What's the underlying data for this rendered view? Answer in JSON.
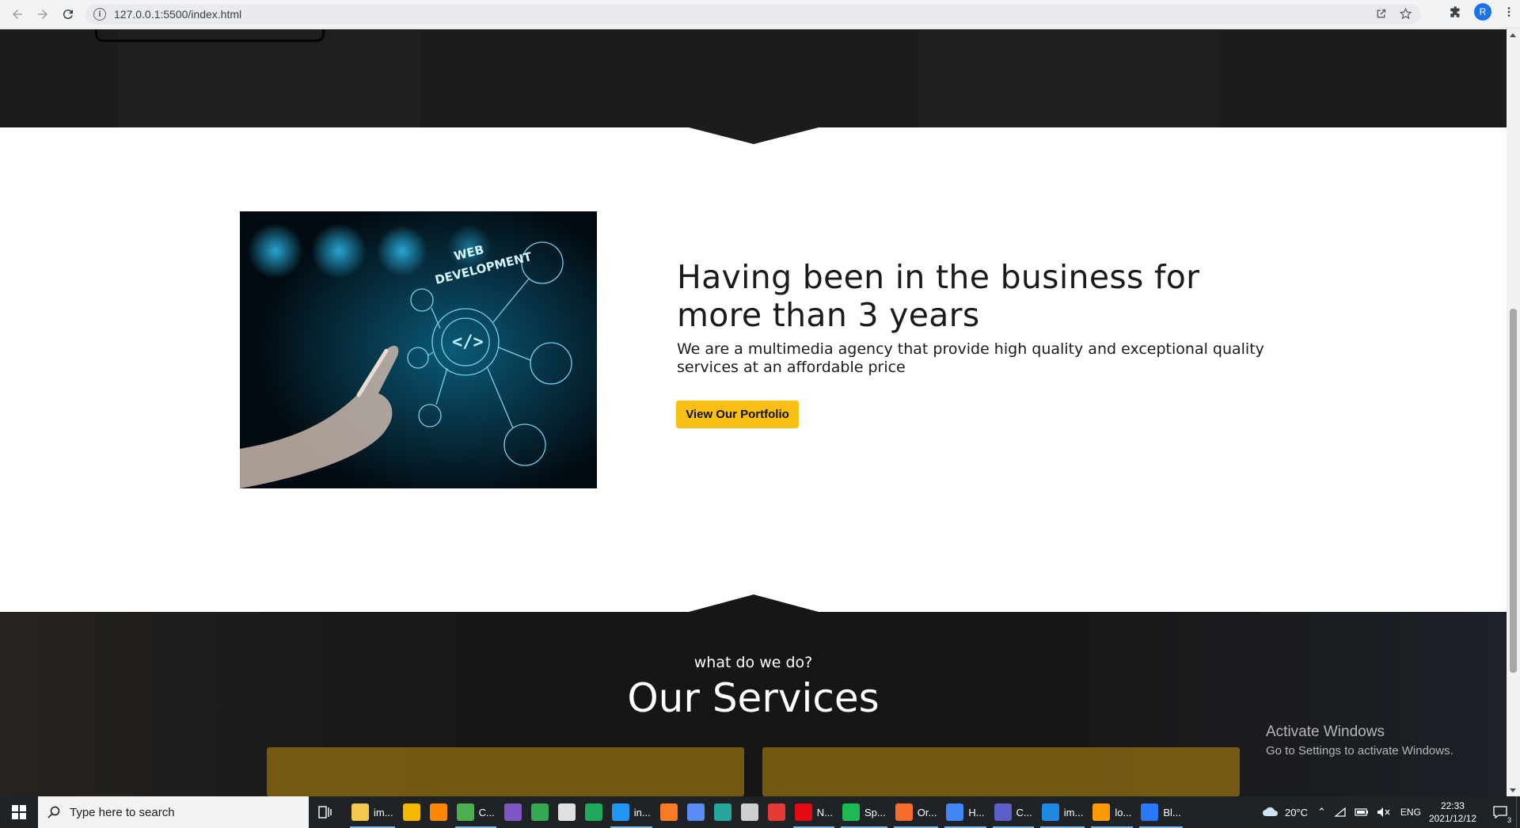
{
  "browser": {
    "url": "127.0.0.1:5500/index.html",
    "profile_initial": "R"
  },
  "about": {
    "title": "Having been in the business for more than 3 years",
    "description": "We are a multimedia agency that provide high quality and exceptional quality services at an affordable price",
    "button_label": "View Our Portfolio",
    "image_caption_line1": "WEB",
    "image_caption_line2": "DEVELOPMENT"
  },
  "services": {
    "subtitle": "what do we do?",
    "title": "Our Services"
  },
  "watermark": {
    "line1": "Activate Windows",
    "line2": "Go to Settings to activate Windows."
  },
  "taskbar": {
    "search_placeholder": "Type here to search",
    "items": [
      {
        "icon": "file-explorer-icon",
        "label": "im...",
        "color": "#f2c94c"
      },
      {
        "icon": "player-icon",
        "label": "",
        "color": "#f5b700"
      },
      {
        "icon": "vlc-icon",
        "label": "",
        "color": "#ff8800"
      },
      {
        "icon": "spreadsheet-icon",
        "label": "C...",
        "color": "#4caf50"
      },
      {
        "icon": "visual-studio-icon",
        "label": "",
        "color": "#7e57c2"
      },
      {
        "icon": "chrome-icon",
        "label": "",
        "color": "#34a853"
      },
      {
        "icon": "cloud-app-icon",
        "label": "",
        "color": "#e0e0e0"
      },
      {
        "icon": "maps-icon",
        "label": "",
        "color": "#1faa59"
      },
      {
        "icon": "vscode-icon",
        "label": "in...",
        "color": "#2196f3"
      },
      {
        "icon": "xampp-icon",
        "label": "",
        "color": "#fb7a24"
      },
      {
        "icon": "music-app-icon",
        "label": "",
        "color": "#5c8df6"
      },
      {
        "icon": "app-3-icon",
        "label": "",
        "color": "#26a69a"
      },
      {
        "icon": "unity-icon",
        "label": "",
        "color": "#cfcfcf"
      },
      {
        "icon": "opera-icon",
        "label": "",
        "color": "#e53935"
      },
      {
        "icon": "netflix-icon",
        "label": "N...",
        "color": "#e50914"
      },
      {
        "icon": "spotify-icon",
        "label": "Sp...",
        "color": "#1db954"
      },
      {
        "icon": "origin-icon",
        "label": "Or...",
        "color": "#f56c2d"
      },
      {
        "icon": "chrome-profile-icon",
        "label": "H...",
        "color": "#4285f4"
      },
      {
        "icon": "teams-icon",
        "label": "C...",
        "color": "#5b5fc7"
      },
      {
        "icon": "photos-icon",
        "label": "im...",
        "color": "#1e88e5"
      },
      {
        "icon": "illustrator-icon",
        "label": "lo...",
        "color": "#ff9a00"
      },
      {
        "icon": "bluetooth-icon",
        "label": "Bl...",
        "color": "#2979ff"
      }
    ],
    "weather": "20°C",
    "language": "ENG",
    "time": "22:33",
    "date": "2021/12/12",
    "notification_count": "3"
  }
}
